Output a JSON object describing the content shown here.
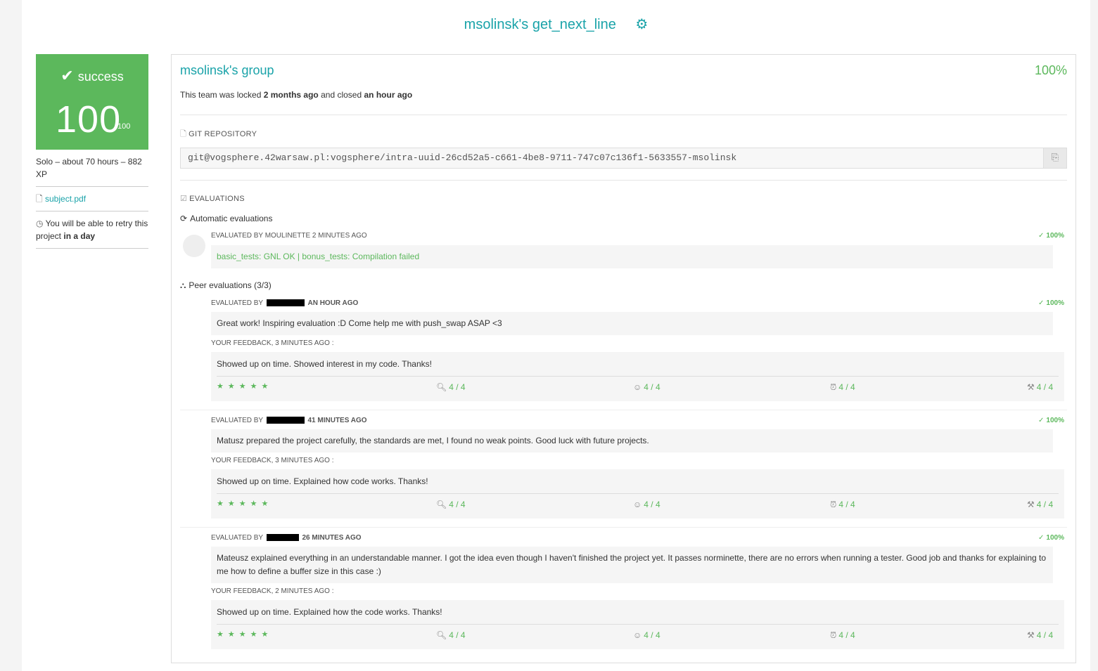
{
  "title": "msolinsk's get_next_line",
  "title_icon": "gear-icon",
  "accent_color": "#1aa3a9",
  "success_color": "#5cb85c",
  "status": {
    "label": "success",
    "score": "100",
    "max": "/100"
  },
  "left": {
    "meta": "Solo – about 70 hours – 882 XP",
    "subject_link": "subject.pdf",
    "retry_prefix": "You will be able to retry this project",
    "retry_when": "in a day"
  },
  "group": {
    "name": "msolinsk's group",
    "percent": "100%",
    "lock_prefix": "This team was locked",
    "locked_ago": "2 months ago",
    "lock_mid": "and closed",
    "closed_ago": "an hour ago"
  },
  "repo": {
    "label": "GIT REPOSITORY",
    "url": "git@vogsphere.42warsaw.pl:vogsphere/intra-uuid-26cd52a5-c661-4be8-9711-747c07c136f1-5633557-msolinsk"
  },
  "evaluations": {
    "label": "EVALUATIONS",
    "auto_heading": "Automatic evaluations",
    "auto": {
      "meta": "EVALUATED BY MOULINETTE 2 MINUTES AGO",
      "percent": "100%",
      "message": "basic_tests: GNL OK | bonus_tests: Compilation failed"
    },
    "peer_heading": "Peer evaluations (3/3)",
    "peers": [
      {
        "meta_prefix": "EVALUATED BY",
        "meta_ago": "AN HOUR AGO",
        "percent": "100%",
        "comment": "Great work! Inspiring evaluation :D Come help me with push_swap ASAP <3",
        "feedback_meta": "YOUR FEEDBACK, 3 MINUTES AGO :",
        "feedback": "Showed up on time. Showed interest in my code. Thanks!",
        "stars": "★★★★★",
        "scores": [
          "4 / 4",
          "4 / 4",
          "4 / 4",
          "4 / 4"
        ]
      },
      {
        "meta_prefix": "EVALUATED BY",
        "meta_ago": "41 MINUTES AGO",
        "percent": "100%",
        "comment": "Matusz prepared the project carefully, the standards are met, I found no weak points. Good luck with future projects.",
        "feedback_meta": "YOUR FEEDBACK, 3 MINUTES AGO :",
        "feedback": "Showed up on time. Explained how code works. Thanks!",
        "stars": "★★★★★",
        "scores": [
          "4 / 4",
          "4 / 4",
          "4 / 4",
          "4 / 4"
        ]
      },
      {
        "meta_prefix": "EVALUATED BY",
        "meta_ago": "26 MINUTES AGO",
        "percent": "100%",
        "comment": "Mateusz explained everything in an understandable manner. I got the idea even though I haven't finished the project yet. It passes norminette, there are no errors when running a tester. Good job and thanks for explaining to me how to define a buffer size in this case :)",
        "feedback_meta": "YOUR FEEDBACK, 2 MINUTES AGO :",
        "feedback": "Showed up on time. Explained how the code works. Thanks!",
        "stars": "★★★★★",
        "scores": [
          "4 / 4",
          "4 / 4",
          "4 / 4",
          "4 / 4"
        ]
      }
    ]
  }
}
